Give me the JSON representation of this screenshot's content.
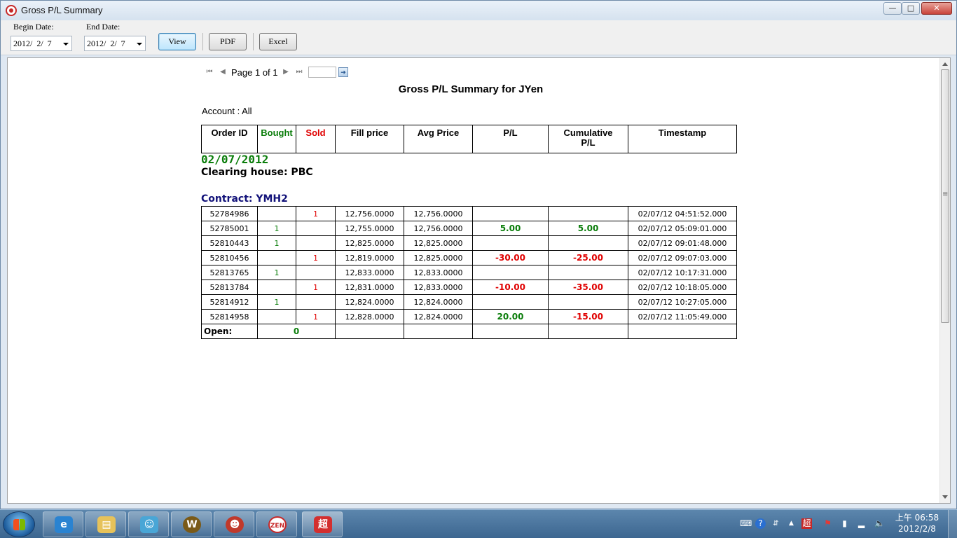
{
  "window": {
    "title": "Gross P/L Summary",
    "minimize_glyph": "—",
    "maximize_glyph": "□",
    "close_glyph": "✕"
  },
  "toolbar": {
    "begin_label": "Begin Date:",
    "begin_value": "2012/  2/  7",
    "end_label": "End Date:",
    "end_value": "2012/  2/  7",
    "view_label": "View",
    "pdf_label": "PDF",
    "excel_label": "Excel"
  },
  "pager": {
    "first_icon": "first-page-icon",
    "prev_icon": "previous-page-icon",
    "text": "Page 1 of 1",
    "next_icon": "next-page-icon",
    "last_icon": "last-page-icon",
    "go_icon": "go-page-icon"
  },
  "report": {
    "title": "Gross P/L Summary for JYen",
    "account": "Account : All",
    "date": "02/07/2012",
    "clearing_house": "Clearing house: PBC",
    "contract": "Contract: YMH2",
    "headers": {
      "order_id": "Order ID",
      "bought": "Bought",
      "sold": "Sold",
      "fill_price": "Fill price",
      "avg_price": "Avg Price",
      "pl": "P/L",
      "cumulative_line1": "Cumulative",
      "cumulative_line2": "P/L",
      "timestamp": "Timestamp"
    },
    "rows": [
      {
        "order_id": "52784986",
        "bought": "",
        "sold": "1",
        "fill": "12,756.0000",
        "avg": "12,756.0000",
        "pl": "",
        "cum": "",
        "ts": "02/07/12 04:51:52.000"
      },
      {
        "order_id": "52785001",
        "bought": "1",
        "sold": "",
        "fill": "12,755.0000",
        "avg": "12,756.0000",
        "pl": "5.00",
        "cum": "5.00",
        "ts": "02/07/12 05:09:01.000"
      },
      {
        "order_id": "52810443",
        "bought": "1",
        "sold": "",
        "fill": "12,825.0000",
        "avg": "12,825.0000",
        "pl": "",
        "cum": "",
        "ts": "02/07/12 09:01:48.000"
      },
      {
        "order_id": "52810456",
        "bought": "",
        "sold": "1",
        "fill": "12,819.0000",
        "avg": "12,825.0000",
        "pl": "-30.00",
        "cum": "-25.00",
        "ts": "02/07/12 09:07:03.000"
      },
      {
        "order_id": "52813765",
        "bought": "1",
        "sold": "",
        "fill": "12,833.0000",
        "avg": "12,833.0000",
        "pl": "",
        "cum": "",
        "ts": "02/07/12 10:17:31.000"
      },
      {
        "order_id": "52813784",
        "bought": "",
        "sold": "1",
        "fill": "12,831.0000",
        "avg": "12,833.0000",
        "pl": "-10.00",
        "cum": "-35.00",
        "ts": "02/07/12 10:18:05.000"
      },
      {
        "order_id": "52814912",
        "bought": "1",
        "sold": "",
        "fill": "12,824.0000",
        "avg": "12,824.0000",
        "pl": "",
        "cum": "",
        "ts": "02/07/12 10:27:05.000"
      },
      {
        "order_id": "52814958",
        "bought": "",
        "sold": "1",
        "fill": "12,828.0000",
        "avg": "12,824.0000",
        "pl": "20.00",
        "cum": "-15.00",
        "ts": "02/07/12 11:05:49.000"
      }
    ],
    "open_label": "Open:",
    "open_value": "0"
  },
  "colors": {
    "bought": "#0a7d0a",
    "sold": "#e00000",
    "positive": "#0a7d0a",
    "negative": "#e00000",
    "contract": "#13137a"
  },
  "taskbar": {
    "apps": [
      "internet-explorer-icon",
      "file-explorer-icon",
      "messenger-icon",
      "world-of-warcraft-icon",
      "game-character-icon",
      "global-zen-icon",
      "trading-app-icon"
    ],
    "clock_time": "上午 06:58",
    "clock_date": "2012/2/8"
  }
}
